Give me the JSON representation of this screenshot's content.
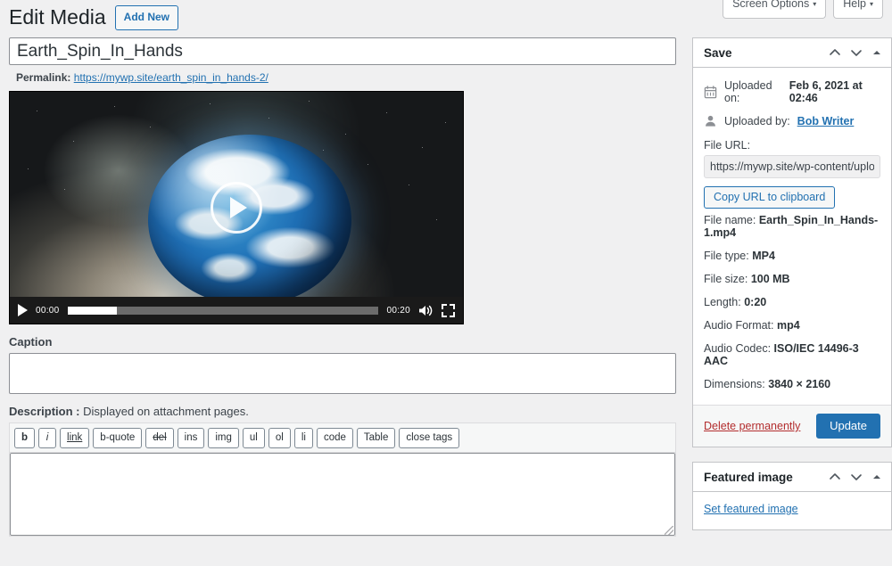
{
  "screen_meta": [
    {
      "label": "Screen Options",
      "caret": "▾"
    },
    {
      "label": "Help",
      "caret": "▾"
    }
  ],
  "header": {
    "page_title": "Edit Media",
    "add_new_label": "Add New"
  },
  "post": {
    "title_value": "Earth_Spin_In_Hands",
    "permalink_label": "Permalink:",
    "permalink_url": "https://mywp.site/earth_spin_in_hands-2/"
  },
  "player": {
    "current_time": "00:00",
    "duration": "00:20",
    "play_icon": "play-icon",
    "volume_icon": "volume-icon",
    "fullscreen_icon": "fullscreen-icon",
    "buffered_percent": 16
  },
  "caption": {
    "label": "Caption",
    "value": "",
    "placeholder": ""
  },
  "description": {
    "label": "Description :",
    "hint": "Displayed on attachment pages.",
    "value": "",
    "placeholder": "",
    "quicktags": [
      {
        "label": "b",
        "style": "bold"
      },
      {
        "label": "i",
        "style": "italic"
      },
      {
        "label": "link",
        "style": "underline"
      },
      {
        "label": "b-quote",
        "style": "plain"
      },
      {
        "label": "del",
        "style": "strike"
      },
      {
        "label": "ins",
        "style": "plain"
      },
      {
        "label": "img",
        "style": "plain"
      },
      {
        "label": "ul",
        "style": "plain"
      },
      {
        "label": "ol",
        "style": "plain"
      },
      {
        "label": "li",
        "style": "plain"
      },
      {
        "label": "code",
        "style": "plain"
      },
      {
        "label": "Table",
        "style": "plain"
      },
      {
        "label": "close tags",
        "style": "plain"
      }
    ]
  },
  "save_panel": {
    "title": "Save",
    "uploaded_on_label": "Uploaded on:",
    "uploaded_on_value": "Feb 6, 2021 at 02:46",
    "uploaded_by_label": "Uploaded by:",
    "uploaded_by_value": "Bob Writer",
    "file_url_label": "File URL:",
    "file_url_value": "https://mywp.site/wp-content/uploads,",
    "copy_url_label": "Copy URL to clipboard",
    "meta": [
      {
        "label": "File name:",
        "value": "Earth_Spin_In_Hands-1.mp4"
      },
      {
        "label": "File type:",
        "value": "MP4"
      },
      {
        "label": "File size:",
        "value": "100 MB"
      },
      {
        "label": "Length:",
        "value": "0:20"
      },
      {
        "label": "Audio Format:",
        "value": "mp4"
      },
      {
        "label": "Audio Codec:",
        "value": "ISO/IEC 14496-3 AAC"
      },
      {
        "label": "Dimensions:",
        "value": "3840 × 2160"
      }
    ],
    "delete_label": "Delete permanently",
    "update_label": "Update"
  },
  "featured_panel": {
    "title": "Featured image",
    "set_link": "Set featured image"
  },
  "colors": {
    "accent": "#2271b1",
    "danger": "#b32d2e",
    "page_bg": "#f0f0f1",
    "border": "#c3c4c7"
  }
}
